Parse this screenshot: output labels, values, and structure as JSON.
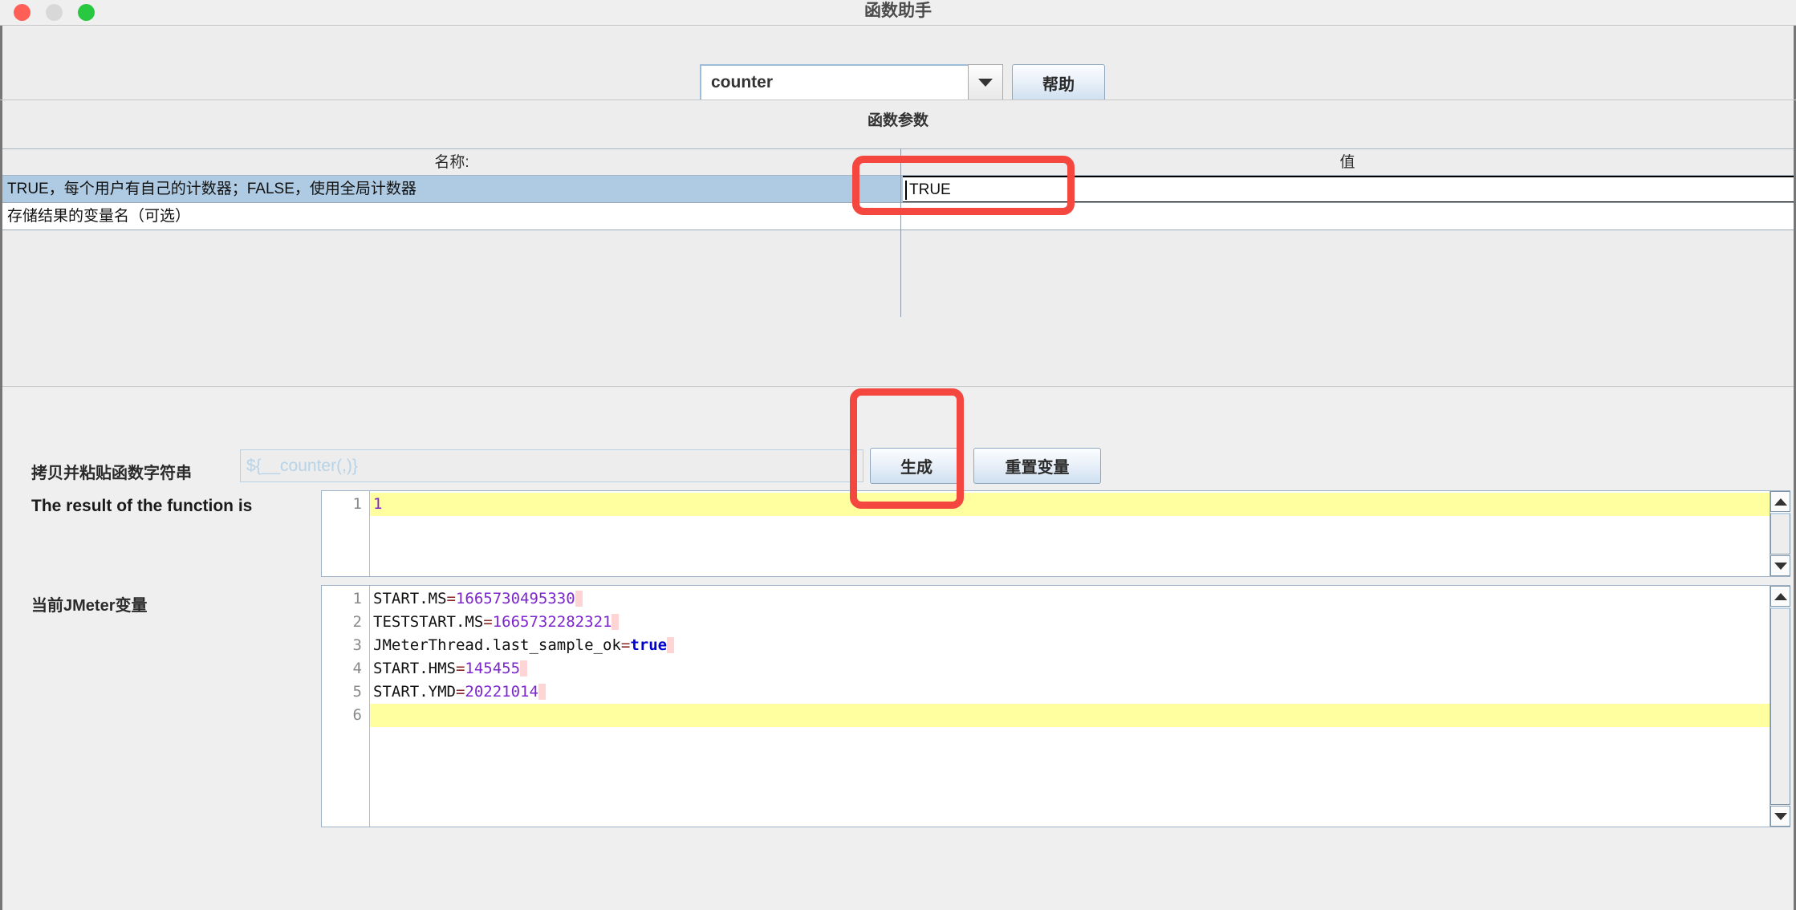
{
  "window": {
    "title": "函数助手",
    "controls": {
      "close": "close",
      "minimize": "minimize",
      "maximize": "maximize"
    }
  },
  "toolbar": {
    "function_select": {
      "value": "counter",
      "arrow_icon": "chevron-down-icon"
    },
    "help_button": "帮助"
  },
  "params": {
    "section_title": "函数参数",
    "columns": {
      "name": "名称:",
      "value": "值"
    },
    "rows": [
      {
        "name": "TRUE，每个用户有自己的计数器；FALSE，使用全局计数器",
        "value": "TRUE",
        "selected": true,
        "editing": true
      },
      {
        "name": "存储结果的变量名（可选）",
        "value": "",
        "selected": false,
        "editing": false
      }
    ]
  },
  "generator": {
    "copy_label": "拷贝并粘贴函数字符串",
    "copy_placeholder": "${__counter(,)}",
    "copy_value": "",
    "generate_button": "生成",
    "reset_button": "重置变量"
  },
  "result": {
    "label": "The result of the function is",
    "line_numbers": [
      "1"
    ],
    "lines": [
      {
        "number": "1",
        "highlighted": true,
        "tokens": [
          {
            "text": "1",
            "type": "num"
          }
        ]
      }
    ]
  },
  "variables": {
    "label": "当前JMeter变量",
    "line_numbers": [
      "1",
      "2",
      "3",
      "4",
      "5",
      "6"
    ],
    "lines": [
      {
        "number": "1",
        "highlighted": false,
        "tokens": [
          {
            "text": "START.MS",
            "type": "key"
          },
          {
            "text": "=",
            "type": "eq"
          },
          {
            "text": "1665730495330",
            "type": "num"
          },
          {
            "text": " ",
            "type": "ws"
          }
        ]
      },
      {
        "number": "2",
        "highlighted": false,
        "tokens": [
          {
            "text": "TESTSTART.MS",
            "type": "key"
          },
          {
            "text": "=",
            "type": "eq"
          },
          {
            "text": "1665732282321",
            "type": "num"
          },
          {
            "text": " ",
            "type": "ws"
          }
        ]
      },
      {
        "number": "3",
        "highlighted": false,
        "tokens": [
          {
            "text": "JMeterThread.last_sample_ok",
            "type": "key"
          },
          {
            "text": "=",
            "type": "eq"
          },
          {
            "text": "true",
            "type": "bool"
          },
          {
            "text": " ",
            "type": "ws"
          }
        ]
      },
      {
        "number": "4",
        "highlighted": false,
        "tokens": [
          {
            "text": "START.HMS",
            "type": "key"
          },
          {
            "text": "=",
            "type": "eq"
          },
          {
            "text": "145455",
            "type": "num"
          },
          {
            "text": " ",
            "type": "ws"
          }
        ]
      },
      {
        "number": "5",
        "highlighted": false,
        "tokens": [
          {
            "text": "START.YMD",
            "type": "key"
          },
          {
            "text": "=",
            "type": "eq"
          },
          {
            "text": "20221014",
            "type": "num"
          },
          {
            "text": " ",
            "type": "ws"
          }
        ]
      },
      {
        "number": "6",
        "highlighted": true,
        "tokens": []
      }
    ]
  },
  "scrollbars": {
    "up_icon": "triangle-up-icon",
    "down_icon": "triangle-down-icon"
  },
  "annotations": [
    {
      "name": "value-cell-highlight",
      "color": "#f4473f"
    },
    {
      "name": "generate-button-highlight",
      "color": "#f4473f"
    }
  ]
}
